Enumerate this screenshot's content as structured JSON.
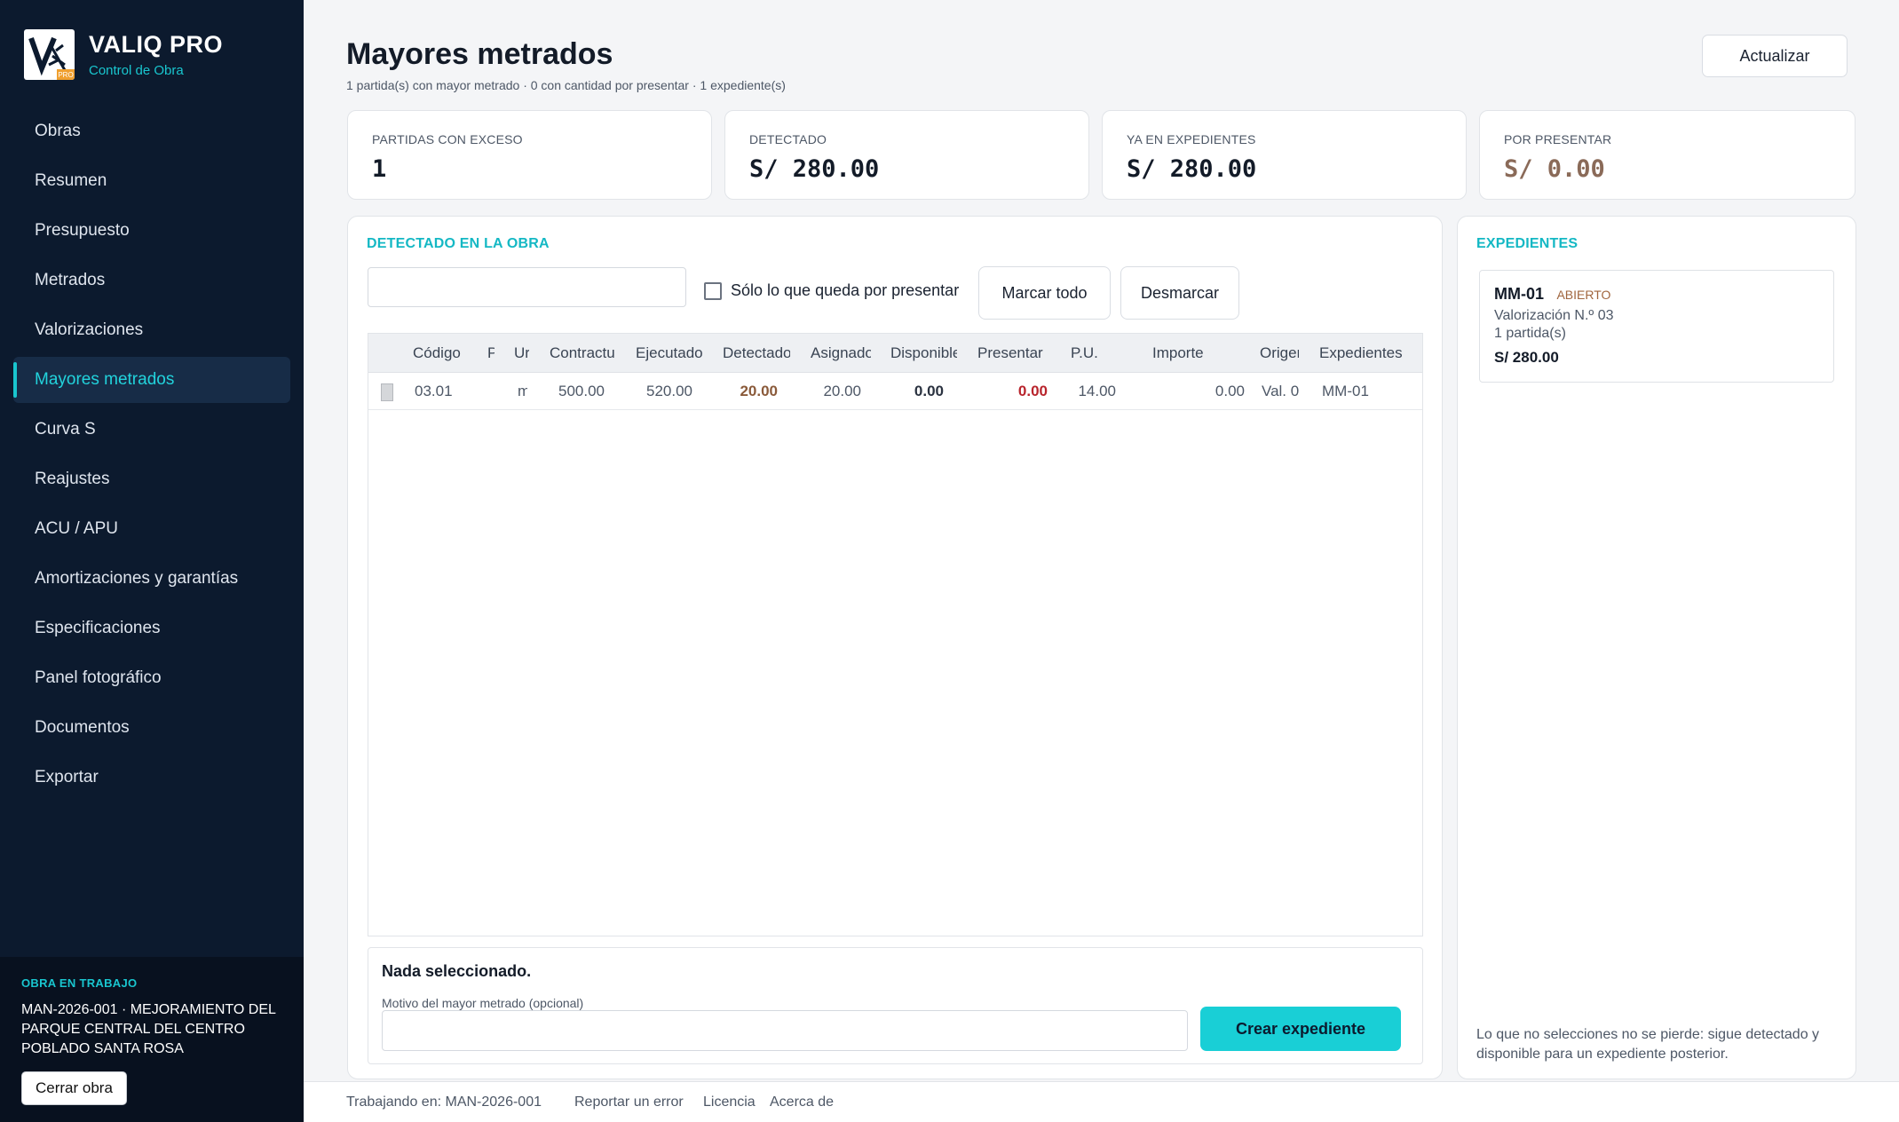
{
  "app": {
    "name": "VALIQ PRO",
    "subtitle": "Control de Obra",
    "logo_badge": "PRO"
  },
  "sidebar": {
    "items": [
      {
        "label": "Obras"
      },
      {
        "label": "Resumen"
      },
      {
        "label": "Presupuesto"
      },
      {
        "label": "Metrados"
      },
      {
        "label": "Valorizaciones"
      },
      {
        "label": "Mayores metrados",
        "active": true
      },
      {
        "label": "Curva S"
      },
      {
        "label": "Reajustes"
      },
      {
        "label": "ACU / APU"
      },
      {
        "label": "Amortizaciones y garantías"
      },
      {
        "label": "Especificaciones"
      },
      {
        "label": "Panel fotográfico"
      },
      {
        "label": "Documentos"
      },
      {
        "label": "Exportar"
      }
    ],
    "obra_label": "OBRA EN TRABAJO",
    "obra_name": "MAN-2026-001 · MEJORAMIENTO DEL PARQUE CENTRAL DEL CENTRO POBLADO SANTA ROSA",
    "close_label": "Cerrar obra"
  },
  "header": {
    "title": "Mayores metrados",
    "subtitle": "1 partida(s) con mayor metrado · 0 con cantidad por presentar · 1 expediente(s)",
    "refresh_label": "Actualizar"
  },
  "stats": [
    {
      "label": "PARTIDAS CON EXCESO",
      "value": "1"
    },
    {
      "label": "DETECTADO",
      "value": "S/ 280.00"
    },
    {
      "label": "YA EN EXPEDIENTES",
      "value": "S/ 280.00"
    },
    {
      "label": "POR PRESENTAR",
      "value": "S/ 0.00"
    }
  ],
  "detected": {
    "title": "DETECTADO EN LA OBRA",
    "search_value": "",
    "search_placeholder": "",
    "only_pending_label": "Sólo lo que queda por presentar",
    "mark_all_label": "Marcar todo",
    "unmark_label": "Desmarcar",
    "columns": [
      "Código",
      "P",
      "Ur",
      "Contractu",
      "Ejecutado",
      "Detectado",
      "Asignado",
      "Disponible",
      "Presentar",
      "P.U.",
      "Importe",
      "Origen",
      "Expedientes"
    ],
    "rows": [
      {
        "codigo": "03.01",
        "partida": "",
        "unidad": "m",
        "contractual": "500.00",
        "ejecutado": "520.00",
        "detectado": "20.00",
        "asignado": "20.00",
        "disponible": "0.00",
        "presentar": "0.00",
        "pu": "14.00",
        "importe": "0.00",
        "origen": "Val. 0",
        "expedientes": "MM-01"
      }
    ]
  },
  "selection": {
    "title": "Nada seleccionado.",
    "motivo_label": "Motivo del mayor metrado (opcional)",
    "motivo_value": "",
    "create_label": "Crear expediente"
  },
  "expedientes": {
    "title": "EXPEDIENTES",
    "items": [
      {
        "code": "MM-01",
        "status": "ABIERTO",
        "valorizacion": "Valorización N.º 03",
        "partidas": "1 partida(s)",
        "amount": "S/ 280.00"
      }
    ],
    "note": "Lo que no selecciones no se pierde: sigue detectado y disponible para un expediente posterior."
  },
  "statusbar": {
    "working": "Trabajando en: MAN-2026-001",
    "report": "Reportar un error",
    "license": "Licencia",
    "about": "Acerca de"
  }
}
